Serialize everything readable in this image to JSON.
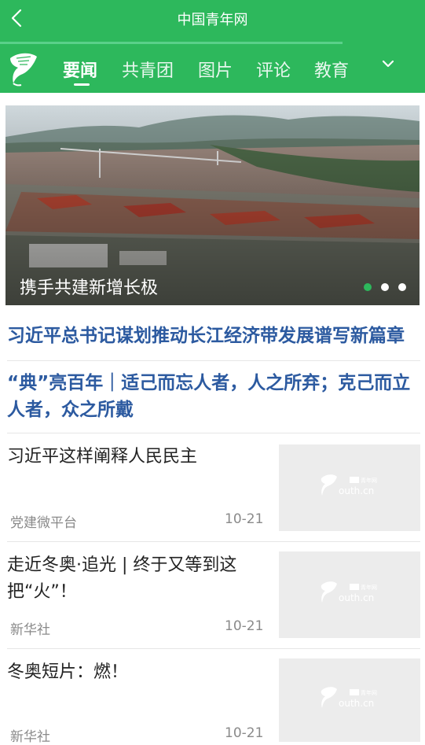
{
  "header": {
    "title": "中国青年网"
  },
  "nav": {
    "tabs": [
      {
        "label": "要闻"
      },
      {
        "label": "共青团"
      },
      {
        "label": "图片"
      },
      {
        "label": "评论"
      },
      {
        "label": "教育"
      }
    ],
    "active_tab": "要闻"
  },
  "banner": {
    "caption": "携手共建新增长极",
    "slide_count": 3,
    "active_slide": 1
  },
  "headlines": [
    {
      "text": "习近平总书记谋划推动长江经济带发展谱写新篇章"
    },
    {
      "text": "“典”亮百年｜适己而忘人者，人之所弃；克己而立人者，众之所戴"
    }
  ],
  "news": [
    {
      "title": "习近平这样阐释人民民主",
      "source": "党建微平台",
      "date": "10-21"
    },
    {
      "title": "走近冬奥·追光 | 终于又等到这把“火”！",
      "source": "新华社",
      "date": "10-21"
    },
    {
      "title": "冬奥短片：燃！",
      "source": "新华社",
      "date": "10-21"
    }
  ],
  "thumbnail": {
    "brand": "youth.cn",
    "brand_cn": "中国青年网"
  },
  "colors": {
    "header_green": "#2db85c",
    "headline_blue": "#2c5aa0",
    "dot_active": "#2db85c"
  }
}
